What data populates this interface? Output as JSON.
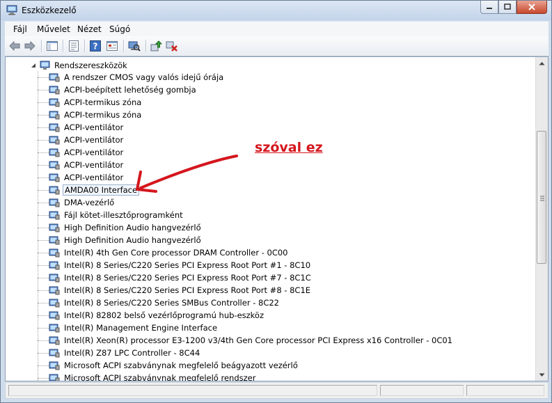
{
  "window": {
    "title": "Eszközkezelő",
    "icon": "device-manager-icon"
  },
  "menu": [
    "Fájl",
    "Művelet",
    "Nézet",
    "Súgó"
  ],
  "toolbar": {
    "icons": [
      "back-icon",
      "forward-icon",
      "show-hide-tree-icon",
      "properties-icon",
      "help-icon",
      "view-icon",
      "scan-hardware-icon",
      "update-driver-icon",
      "uninstall-icon"
    ]
  },
  "tree": {
    "root_label": "Rendszereszközök",
    "items": [
      "A rendszer CMOS vagy valós idejű órája",
      "ACPI-beépített lehetőség gombja",
      "ACPI-termikus zóna",
      "ACPI-termikus zóna",
      "ACPI-ventilátor",
      "ACPI-ventilátor",
      "ACPI-ventilátor",
      "ACPI-ventilátor",
      "ACPI-ventilátor",
      "AMDA00 Interface",
      "DMA-vezérlő",
      "Fájl kötet-illesztőprogramként",
      "High Definition Audio hangvezérlő",
      "High Definition Audio hangvezérlő",
      "Intel(R) 4th Gen Core processor DRAM Controller - 0C00",
      "Intel(R) 8 Series/C220 Series PCI Express Root Port #1 - 8C10",
      "Intel(R) 8 Series/C220 Series PCI Express Root Port #7 - 8C1C",
      "Intel(R) 8 Series/C220 Series PCI Express Root Port #8 - 8C1E",
      "Intel(R) 8 Series/C220 Series SMBus Controller - 8C22",
      "Intel(R) 82802 belső vezérlőprogramú hub-eszköz",
      "Intel(R) Management Engine Interface",
      "Intel(R) Xeon(R) processor E3-1200 v3/4th Gen Core processor PCI Express x16 Controller - 0C01",
      "Intel(R) Z87 LPC Controller - 8C44",
      "Microsoft ACPI szabványnak megfelelő beágyazott vezérlő",
      "Microsoft ACPI szabványnak megfelelő rendszer"
    ],
    "selected_item": "AMDA00 Interface"
  },
  "annotation": {
    "text": "szóval ez",
    "color": "#d4161d"
  }
}
